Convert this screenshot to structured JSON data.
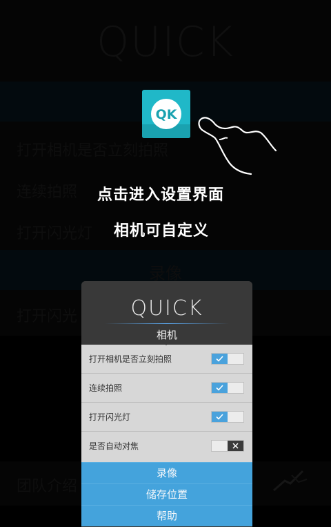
{
  "background": {
    "logo": "QUICK",
    "rows": [
      "打开相机是否立刻拍照",
      "连续拍照",
      "打开闪光灯"
    ],
    "section_title": "录像",
    "video_row": "打开闪光",
    "team_row": "团队介绍"
  },
  "overlay": {
    "app_icon_text": "QK",
    "hint_line1": "点击进入设置界面",
    "hint_line2": "相机可自定义"
  },
  "card": {
    "logo": "QUICK",
    "subtitle": "相机",
    "settings": [
      {
        "label": "打开相机是否立刻拍照",
        "enabled": true
      },
      {
        "label": "连续拍照",
        "enabled": true
      },
      {
        "label": "打开闪光灯",
        "enabled": true
      },
      {
        "label": "是否自动对焦",
        "enabled": false
      }
    ],
    "buttons": [
      "录像",
      "储存位置",
      "帮助"
    ]
  },
  "colors": {
    "accent_blue": "#44a3dc",
    "icon_teal": "#20b8c8",
    "toggle_off": "#3b3b3b"
  },
  "icons": {
    "check": "check-icon",
    "cross": "close-icon",
    "hand": "pointing-hand-icon"
  }
}
